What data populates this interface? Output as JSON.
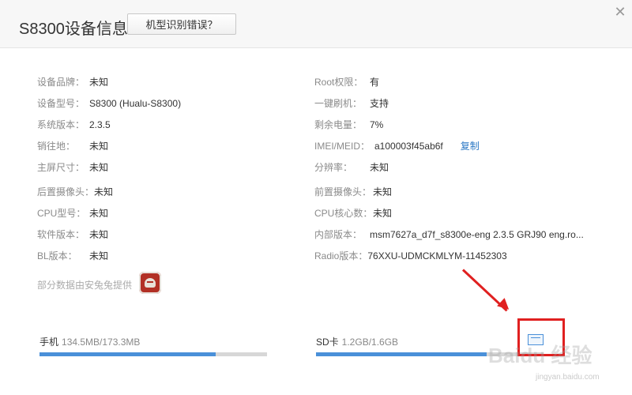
{
  "header": {
    "title": "S8300设备信息",
    "wrong_model_button": "机型识别错误？",
    "close_glyph": "✕"
  },
  "left_fields": [
    {
      "label": "设备品牌：",
      "value": "未知"
    },
    {
      "label": "设备型号：",
      "value": "S8300 (Hualu-S8300)"
    },
    {
      "label": "系统版本：",
      "value": "2.3.5"
    },
    {
      "label": "销往地：",
      "value": "未知"
    },
    {
      "label": "主屏尺寸：",
      "value": "未知"
    },
    {
      "label": "后置摄像头：",
      "value": "未知"
    },
    {
      "label": "CPU型号：",
      "value": "未知"
    },
    {
      "label": "软件版本：",
      "value": "未知"
    },
    {
      "label": "BL版本：",
      "value": "未知"
    }
  ],
  "right_fields": [
    {
      "label": "Root权限：",
      "value": "有"
    },
    {
      "label": "一键刷机：",
      "value": "支持"
    },
    {
      "label": "剩余电量：",
      "value": "7%"
    },
    {
      "label": "IMEI/MEID：",
      "value": "a100003f45ab6f",
      "action": "复制"
    },
    {
      "label": "分辨率：",
      "value": "未知"
    },
    {
      "label": "前置摄像头：",
      "value": "未知"
    },
    {
      "label": "CPU核心数：",
      "value": "未知"
    },
    {
      "label": "内部版本：",
      "value": "msm7627a_d7f_s8300e-eng 2.3.5 GRJ90 eng.ro..."
    },
    {
      "label": "Radio版本：",
      "value": "76XXU-UDMCKMLYM-11452303"
    }
  ],
  "source_note": "部分数据由安兔兔提供",
  "storage": {
    "phone": {
      "label": "手机",
      "amount": "134.5MB/173.3MB",
      "fraction": 0.776
    },
    "sd": {
      "label": "SD卡",
      "amount": "1.2GB/1.6GB",
      "fraction": 0.75
    }
  },
  "watermark": {
    "text": "Baidu 经验",
    "sub": "jingyan.baidu.com"
  },
  "colors": {
    "accent": "#4a90d9",
    "link": "#2b78c5",
    "annotation": "#e02020"
  },
  "icons": [
    "close-icon",
    "antutu-logo-icon",
    "sd-card-icon"
  ]
}
